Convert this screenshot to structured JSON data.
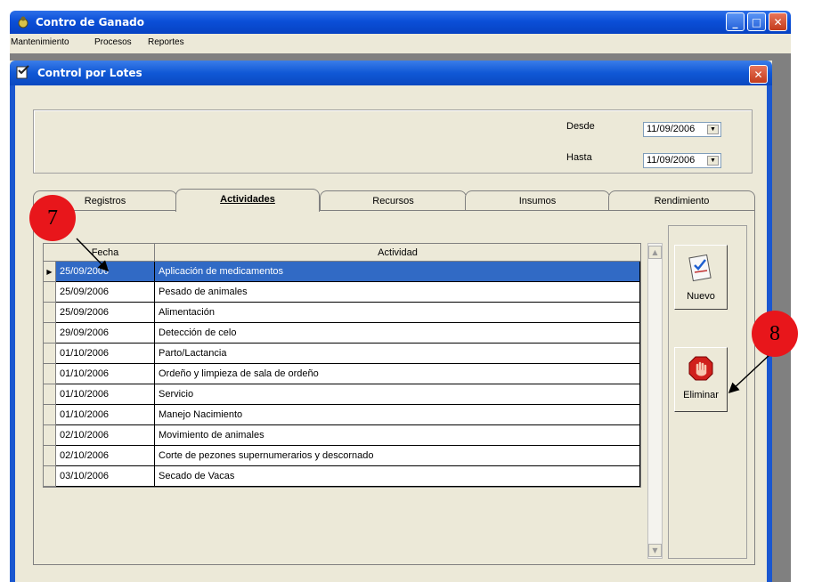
{
  "app": {
    "title": "Contro de Ganado",
    "menu": [
      "Mantenimiento",
      "Procesos",
      "Reportes"
    ]
  },
  "window": {
    "title": "Control por Lotes"
  },
  "dates": {
    "desde_label": "Desde",
    "desde_value": "11/09/2006",
    "hasta_label": "Hasta",
    "hasta_value": "11/09/2006"
  },
  "tabs": [
    {
      "label": "Registros",
      "active": false
    },
    {
      "label": "Actividades",
      "active": true
    },
    {
      "label": "Recursos",
      "active": false
    },
    {
      "label": "Insumos",
      "active": false
    },
    {
      "label": "Rendimiento",
      "active": false
    }
  ],
  "grid": {
    "columns": [
      "Fecha",
      "Actividad"
    ],
    "rows": [
      {
        "fecha": "25/09/2006",
        "actividad": "Aplicación de medicamentos",
        "selected": true
      },
      {
        "fecha": "25/09/2006",
        "actividad": "Pesado de animales"
      },
      {
        "fecha": "25/09/2006",
        "actividad": "Alimentación"
      },
      {
        "fecha": "29/09/2006",
        "actividad": "Detección de celo"
      },
      {
        "fecha": "01/10/2006",
        "actividad": "Parto/Lactancia"
      },
      {
        "fecha": "01/10/2006",
        "actividad": "Ordeño y limpieza de sala de ordeño"
      },
      {
        "fecha": "01/10/2006",
        "actividad": "Servicio"
      },
      {
        "fecha": "01/10/2006",
        "actividad": "Manejo Nacimiento"
      },
      {
        "fecha": "02/10/2006",
        "actividad": "Movimiento de animales"
      },
      {
        "fecha": "02/10/2006",
        "actividad": "Corte de pezones supernumerarios y descornado"
      },
      {
        "fecha": "03/10/2006",
        "actividad": "Secado de Vacas"
      }
    ]
  },
  "buttons": {
    "nuevo": "Nuevo",
    "eliminar": "Eliminar"
  },
  "callouts": [
    "7",
    "8"
  ],
  "colors": {
    "titlebar": "#0b4fd8",
    "selection": "#316ac5",
    "callout": "#e8161b"
  }
}
